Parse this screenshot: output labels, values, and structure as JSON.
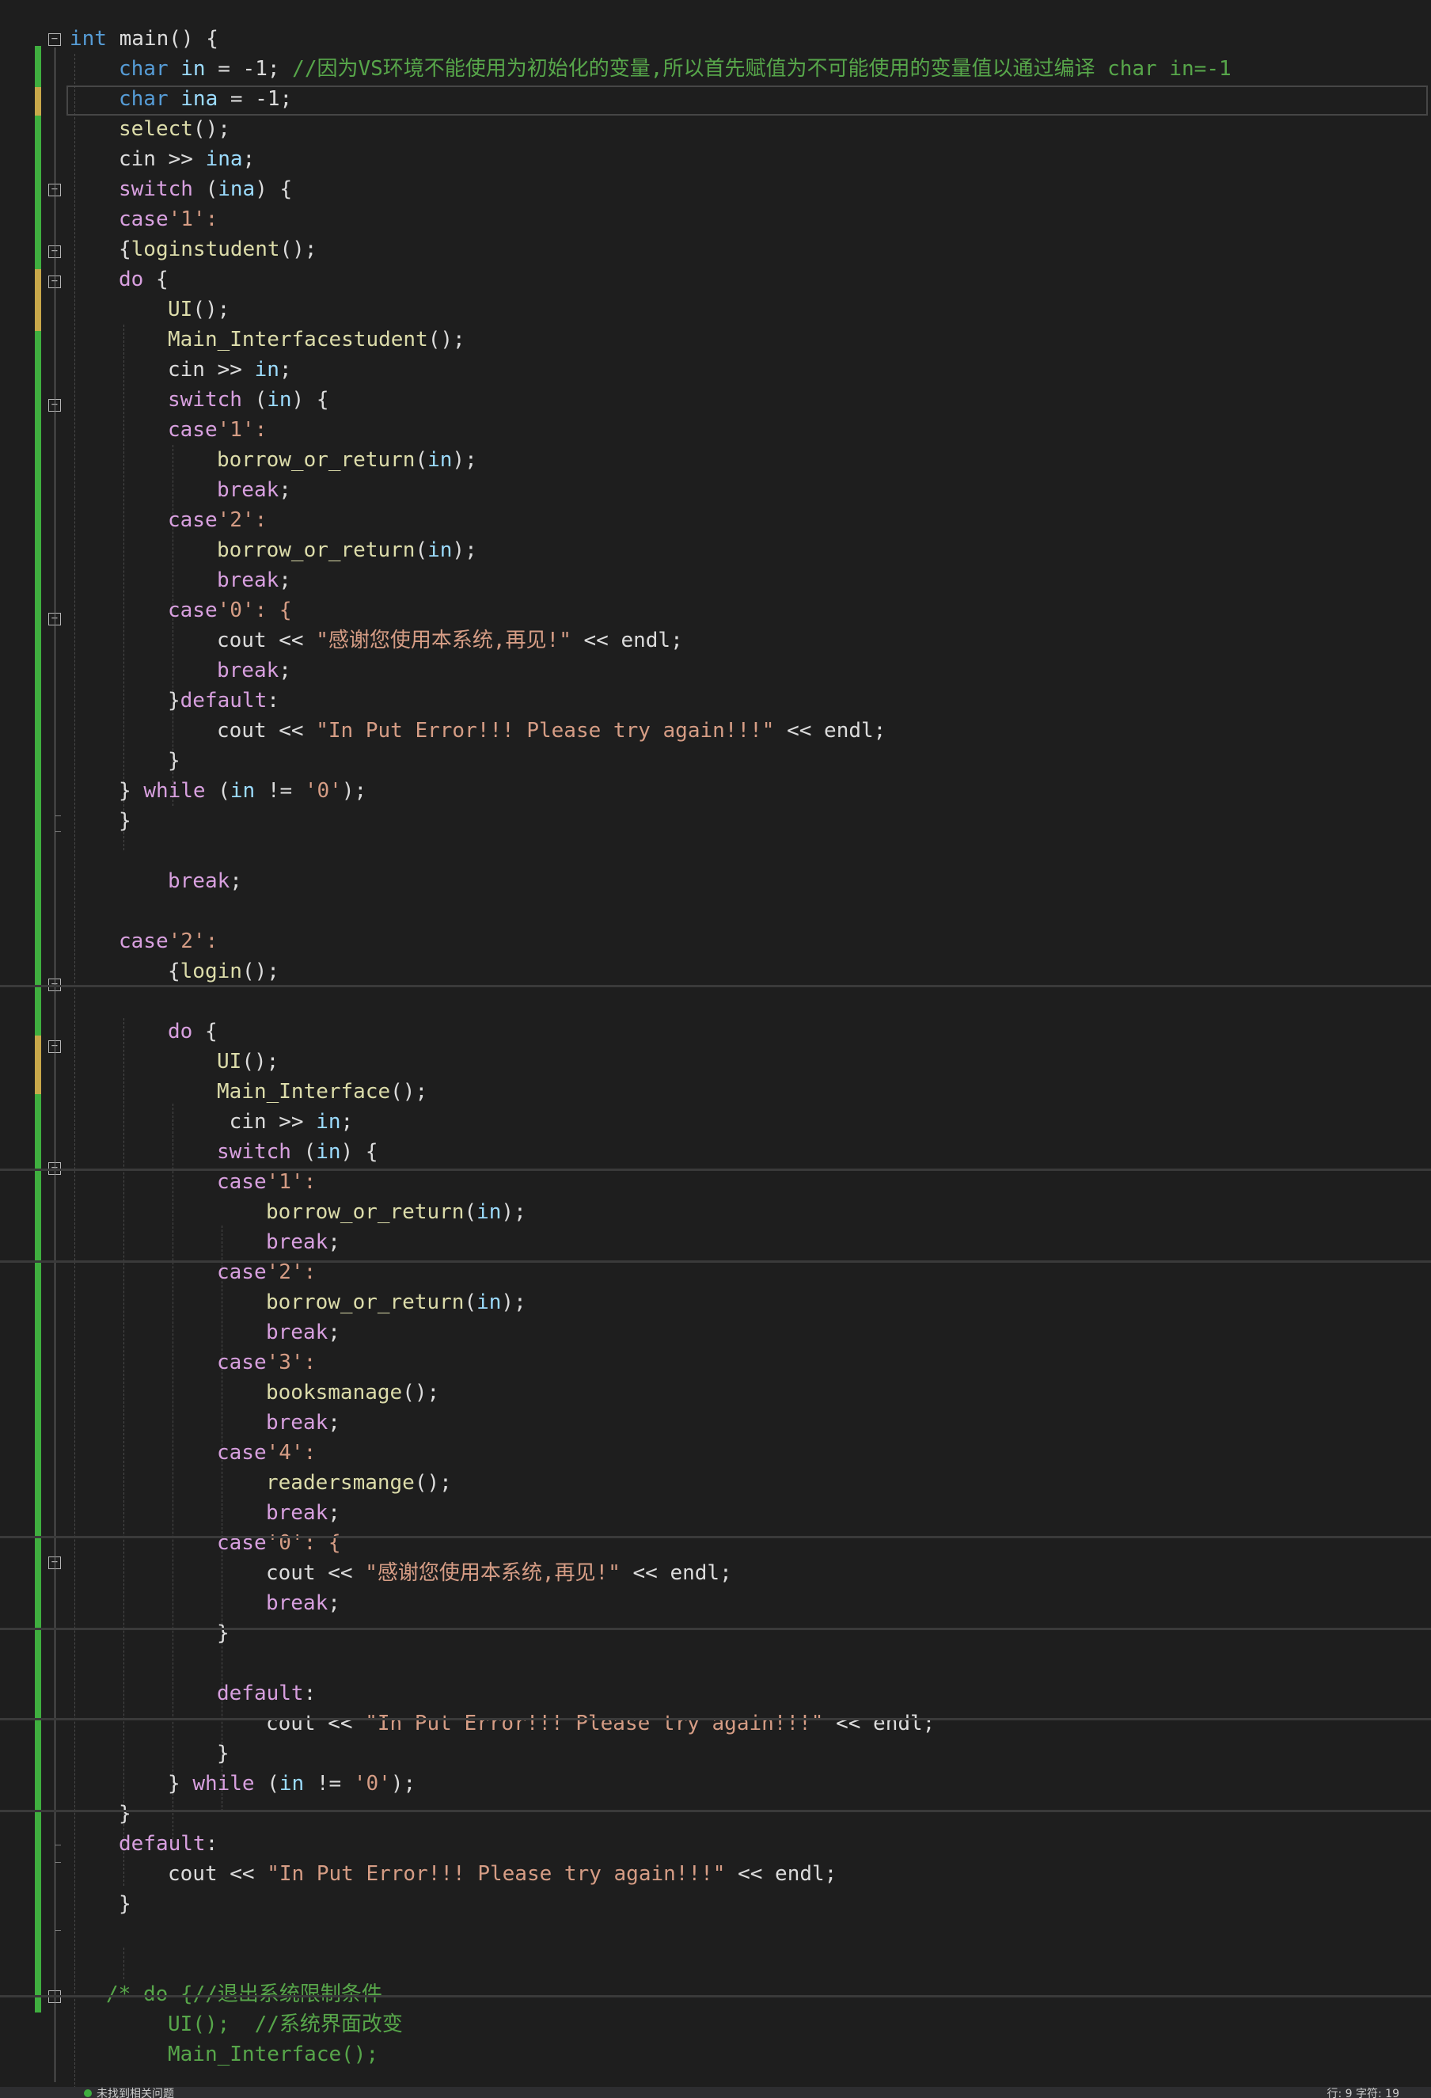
{
  "editor": {
    "language": "C++",
    "colors": {
      "background": "#1e1e1e",
      "keyword": "#569cd6",
      "control": "#d8a0df",
      "function": "#dcdcaa",
      "variable": "#9cdcfe",
      "string": "#d69d85",
      "comment": "#57a64a",
      "change_bar": "#3fae3f"
    },
    "code": {
      "l1": [
        "int",
        " main() {"
      ],
      "l2": [
        "char",
        " ",
        "in",
        " = -1; ",
        "//因为VS环境不能使用为初始化的变量,所以首先赋值为不可能使用的变量值以通过编译 char in=-1"
      ],
      "l3": [
        "char",
        " ",
        "ina",
        " = -1;"
      ],
      "l4": [
        "select",
        "();"
      ],
      "l5": [
        "cin >> ",
        "ina",
        ";"
      ],
      "l6": [
        "switch",
        " (",
        "ina",
        ") {"
      ],
      "l7": [
        "case",
        "'1':"
      ],
      "l8": [
        "{",
        "loginstudent",
        "();"
      ],
      "l9": [
        "do",
        " {"
      ],
      "l10": [
        "UI",
        "();"
      ],
      "l11": [
        "Main_Interfacestudent",
        "();"
      ],
      "l12": [
        "cin >> ",
        "in",
        ";"
      ],
      "l13": [
        "switch",
        " (",
        "in",
        ") {"
      ],
      "l14": [
        "case",
        "'1':"
      ],
      "l15": [
        "borrow_or_return",
        "(",
        "in",
        ");"
      ],
      "l16": [
        "break",
        ";"
      ],
      "l17": [
        "case",
        "'2':"
      ],
      "l18": [
        "borrow_or_return",
        "(",
        "in",
        ");"
      ],
      "l19": [
        "break",
        ";"
      ],
      "l20": [
        "case",
        "'0': {"
      ],
      "l21": [
        "cout << ",
        "\"感谢您使用本系统,再见!\"",
        " << endl;"
      ],
      "l22": [
        "break",
        ";"
      ],
      "l23": [
        "}",
        "default",
        ":"
      ],
      "l24": [
        "cout << ",
        "\"In Put Error!!! Please try again!!!\"",
        " << endl;"
      ],
      "l25": [
        "}"
      ],
      "l26": [
        "} ",
        "while",
        " (",
        "in",
        " != ",
        "'0'",
        ");"
      ],
      "l27": [
        "}"
      ],
      "l29": [
        "break",
        ";"
      ],
      "l31": [
        "case",
        "'2':"
      ],
      "l32": [
        "{",
        "login",
        "();"
      ],
      "l34": [
        "do",
        " {"
      ],
      "l35": [
        "UI",
        "();"
      ],
      "l36": [
        "Main_Interface",
        "();"
      ],
      "l37": [
        " cin >> ",
        "in",
        ";"
      ],
      "l38": [
        "switch",
        " (",
        "in",
        ") {"
      ],
      "l39": [
        "case",
        "'1':"
      ],
      "l40": [
        "borrow_or_return",
        "(",
        "in",
        ");"
      ],
      "l41": [
        "break",
        ";"
      ],
      "l42": [
        "case",
        "'2':"
      ],
      "l43": [
        "borrow_or_return",
        "(",
        "in",
        ");"
      ],
      "l44": [
        "break",
        ";"
      ],
      "l45": [
        "case",
        "'3':"
      ],
      "l46": [
        "booksmanage",
        "();"
      ],
      "l47": [
        "break",
        ";"
      ],
      "l48": [
        "case",
        "'4':"
      ],
      "l49": [
        "readersmange",
        "();"
      ],
      "l50": [
        "break",
        ";"
      ],
      "l51": [
        "case",
        "'0': {"
      ],
      "l52": [
        "cout << ",
        "\"感谢您使用本系统,再见!\"",
        " << endl;"
      ],
      "l53": [
        "break",
        ";"
      ],
      "l54": [
        "}"
      ],
      "l56": [
        "default",
        ":"
      ],
      "l57": [
        "cout << ",
        "\"In Put Error!!! Please try again!!!\"",
        " << endl;"
      ],
      "l58": [
        "}"
      ],
      "l59": [
        "} ",
        "while",
        " (",
        "in",
        " != ",
        "'0'",
        ");"
      ],
      "l60": [
        "}"
      ],
      "l61": [
        "default",
        ":"
      ],
      "l62": [
        "cout << ",
        "\"In Put Error!!! Please try again!!!\"",
        " << endl;"
      ],
      "l63": [
        "}"
      ],
      "l65": [
        "/* do {//退出系统限制条件"
      ],
      "l66": [
        "UI();  //系统界面改变"
      ],
      "l67": [
        "Main_Interface();"
      ]
    }
  },
  "status_bar": {
    "issues": "未找到相关问题",
    "position": "行: 9    字符: 19"
  }
}
